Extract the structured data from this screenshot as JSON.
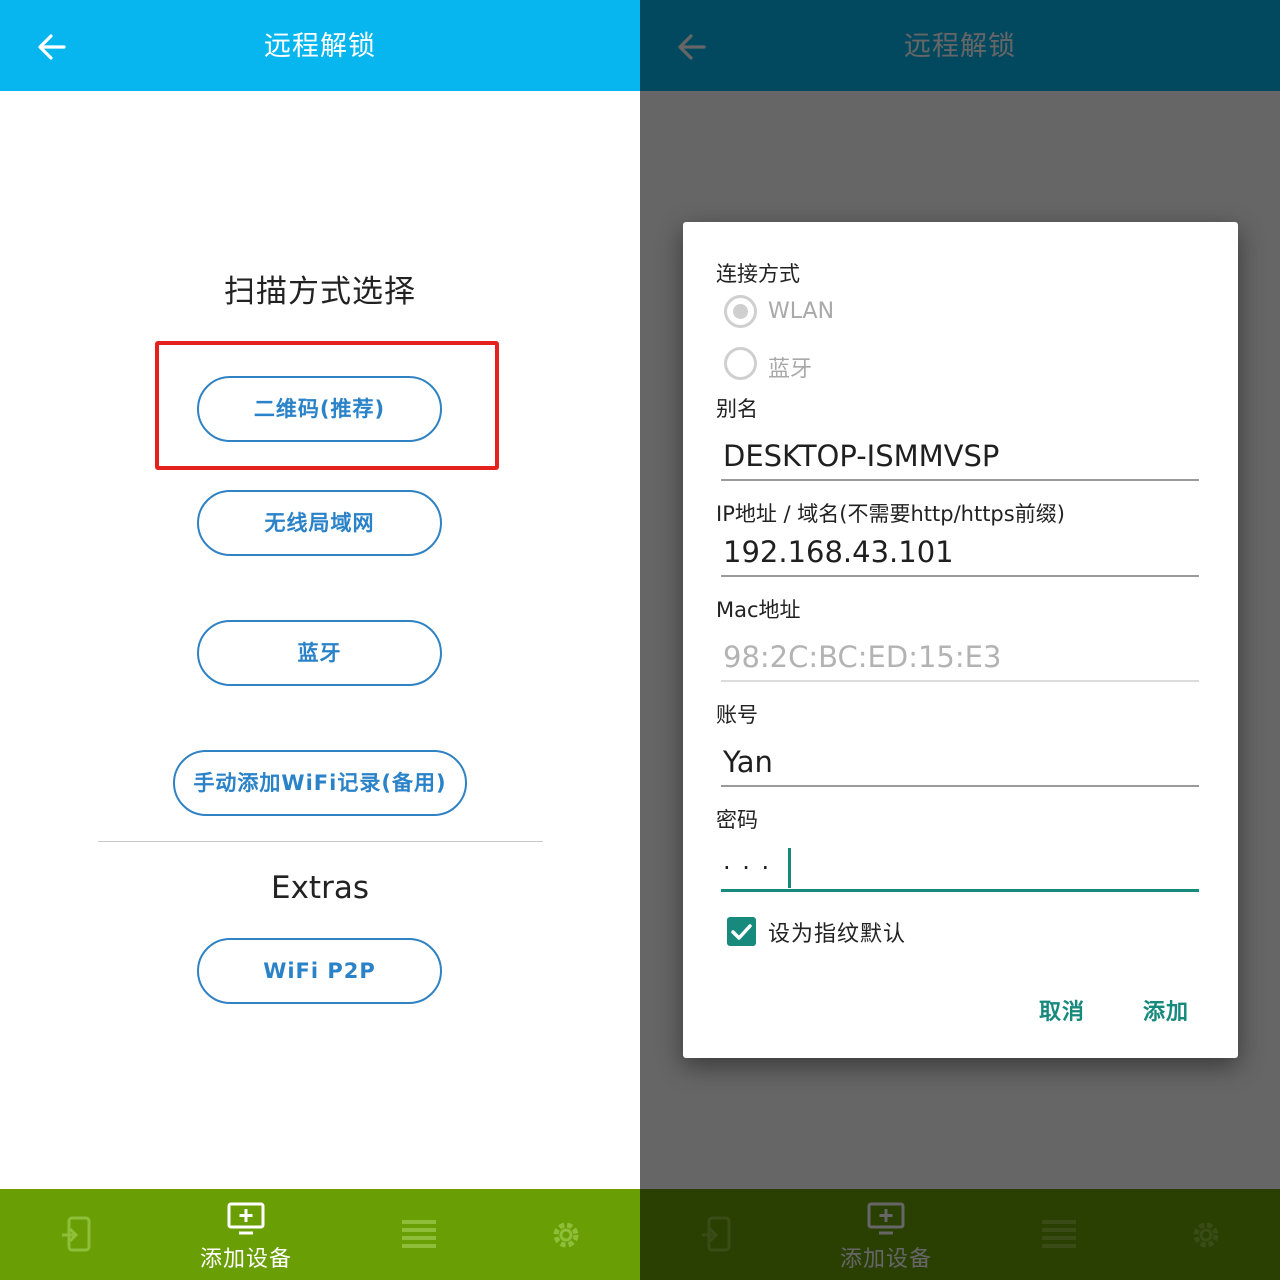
{
  "app_bar": {
    "title": "远程解锁",
    "back_icon": "arrow-left-icon"
  },
  "left": {
    "scan_title": "扫描方式选择",
    "buttons": {
      "qrcode": "二维码(推荐)",
      "wlan": "无线局域网",
      "bluetooth": "蓝牙",
      "manual_wifi": "手动添加WiFi记录(备用)",
      "wifi_p2p": "WiFi P2P"
    },
    "extras_title": "Extras",
    "highlighted_button": "二维码(推荐)"
  },
  "bottom_nav": {
    "active_label": "添加设备",
    "tabs": [
      {
        "icon": "phone-exit-icon"
      },
      {
        "icon": "monitor-add-icon",
        "label": "添加设备",
        "active": true
      },
      {
        "icon": "list-icon"
      },
      {
        "icon": "gear-icon"
      }
    ]
  },
  "dialog": {
    "connection_label": "连接方式",
    "options": [
      {
        "label": "WLAN",
        "selected": true
      },
      {
        "label": "蓝牙",
        "selected": false
      }
    ],
    "alias_label": "别名",
    "alias_value": "DESKTOP-ISMMVSP",
    "ip_label": "IP地址 / 域名(不需要http/https前缀)",
    "ip_value": "192.168.43.101",
    "mac_label": "Mac地址",
    "mac_value": "98:2C:BC:ED:15:E3",
    "account_label": "账号",
    "account_value": "Yan",
    "password_label": "密码",
    "password_value": "· · ·",
    "fingerprint_label": "设为指纹默认",
    "fingerprint_checked": true,
    "cancel": "取消",
    "add": "添加"
  },
  "colors": {
    "app_bar": "#07b6ee",
    "bottom_nav": "#6a9e05",
    "pill_border": "#2f82c4",
    "highlight": "#e4211d",
    "accent_teal": "#17897d"
  }
}
